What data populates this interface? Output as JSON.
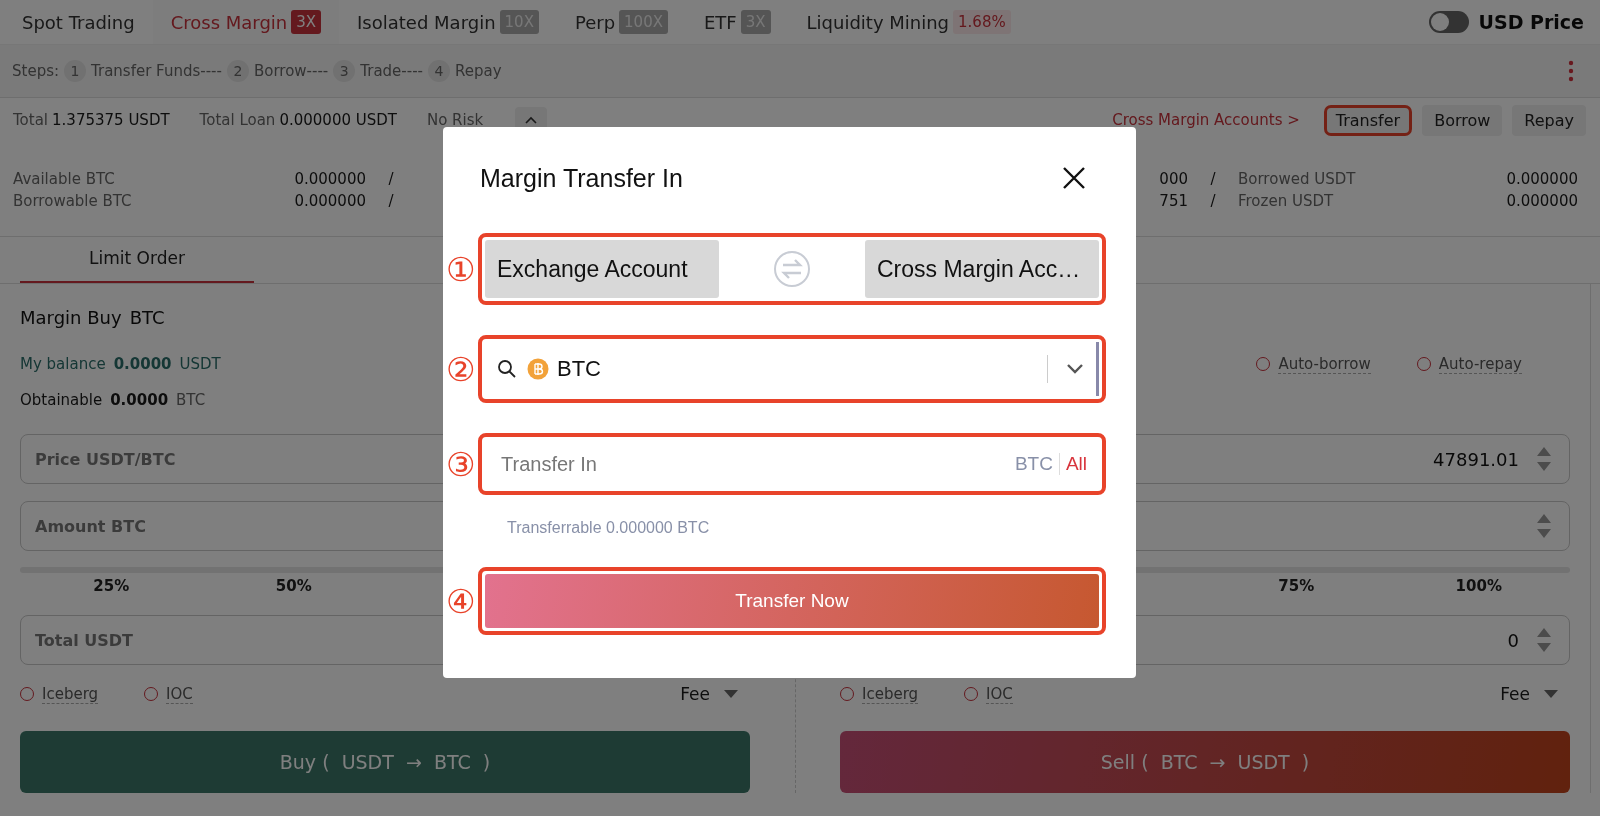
{
  "tabs": [
    {
      "label": "Spot Trading",
      "selected": false
    },
    {
      "label": "Cross Margin",
      "badge": "3X",
      "kind": "leverage",
      "selected": true
    },
    {
      "label": "Isolated Margin",
      "badge": "10X",
      "kind": "leverage",
      "selected": false
    },
    {
      "label": "Perp",
      "badge": "100X",
      "kind": "leverage",
      "selected": false
    },
    {
      "label": "ETF",
      "badge": "3X",
      "kind": "leverage",
      "selected": false
    },
    {
      "label": "Liquidity Mining",
      "badge": "1.68%",
      "kind": "rate",
      "selected": false
    }
  ],
  "usd_price": {
    "label": "USD Price",
    "on": false
  },
  "steps": {
    "label": "Steps:",
    "items": [
      {
        "number": "1",
        "label": "Transfer Funds----"
      },
      {
        "number": "2",
        "label": "Borrow----"
      },
      {
        "number": "3",
        "label": "Trade----"
      },
      {
        "number": "4",
        "label": "Repay"
      }
    ]
  },
  "summary": {
    "total_label": "Total",
    "total_value": "1.375375 USDT",
    "loan_label": "Total Loan",
    "loan_value": "0.000000 USDT",
    "risk": "No Risk",
    "accounts_link": "Cross Margin Accounts >",
    "buttons": [
      {
        "label": "Transfer",
        "highlighted": true
      },
      {
        "label": "Borrow",
        "highlighted": false
      },
      {
        "label": "Repay",
        "highlighted": false
      }
    ]
  },
  "stats_left": [
    {
      "label": "Available BTC",
      "value": "0.000000",
      "separator": "/"
    },
    {
      "label": "Borrowable BTC",
      "value": "0.000000",
      "separator": "/"
    }
  ],
  "stats_right": [
    {
      "value": "000",
      "separator": "/",
      "label": "Borrowed USDT",
      "amount": "0.000000"
    },
    {
      "value": "751",
      "separator": "/",
      "label": "Frozen USDT",
      "amount": "0.000000"
    }
  ],
  "order_tab": {
    "label": "Limit Order",
    "selected": true
  },
  "buy_panel": {
    "title": "Margin Buy",
    "asset": "BTC",
    "balance_label": "My balance",
    "balance_value": "0.0000",
    "balance_unit": "USDT",
    "obtainable_label": "Obtainable",
    "obtainable_value": "0.0000",
    "obtainable_unit": "BTC",
    "fields": [
      {
        "label": "Price USDT/BTC"
      },
      {
        "label": "Amount BTC"
      }
    ],
    "slider": {
      "level": 0
    },
    "percents": [
      "25%",
      "50%"
    ],
    "total_field": {
      "label": "Total USDT"
    },
    "options": [
      {
        "label": "Iceberg",
        "checked": false
      },
      {
        "label": "IOC",
        "checked": false
      }
    ],
    "fee": "Fee",
    "button": "Buy (  USDT  →  BTC  )"
  },
  "sell_panel": {
    "auto_options": [
      {
        "label": "Auto-borrow",
        "checked": false
      },
      {
        "label": "Auto-repay",
        "checked": false
      }
    ],
    "price_value": "47891.01",
    "slider": {
      "level": 0
    },
    "percents": [
      "75%",
      "100%"
    ],
    "total_field": {
      "value": "0"
    },
    "options": [
      {
        "label": "Iceberg",
        "checked": false
      },
      {
        "label": "IOC",
        "checked": false
      }
    ],
    "fee": "Fee",
    "button": "Sell (  BTC  →  USDT  )"
  },
  "dialog": {
    "title": "Margin Transfer In",
    "accounts": {
      "marker": "①",
      "from": "Exchange Account",
      "to": "Cross Margin Acc…"
    },
    "coin": {
      "marker": "②",
      "value": "BTC"
    },
    "amount": {
      "marker": "③",
      "placeholder": "Transfer In",
      "unit": "BTC",
      "all": "All"
    },
    "transferrable": "Transferrable 0.000000 BTC",
    "submit": {
      "marker": "④",
      "label": "Transfer Now"
    }
  }
}
